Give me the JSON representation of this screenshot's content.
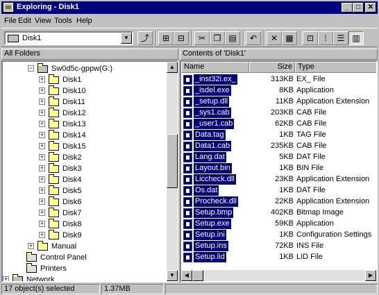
{
  "window": {
    "title": "Exploring - Disk1",
    "min": "_",
    "max": "□",
    "close": "✕"
  },
  "menu": [
    "File",
    "Edit",
    "View",
    "Tools",
    "Help"
  ],
  "address": {
    "value": "Disk1"
  },
  "panes": {
    "left_title": "All Folders",
    "right_title": "Contents of 'Disk1'"
  },
  "tree": [
    {
      "label": "Sw0d5c-gppw(G:)",
      "level": 0,
      "exp": "−",
      "type": "drive"
    },
    {
      "label": "Disk1",
      "level": 1,
      "exp": "+",
      "type": "open"
    },
    {
      "label": "Disk10",
      "level": 1,
      "exp": "+",
      "type": "folder"
    },
    {
      "label": "Disk11",
      "level": 1,
      "exp": "+",
      "type": "folder"
    },
    {
      "label": "Disk12",
      "level": 1,
      "exp": "+",
      "type": "folder"
    },
    {
      "label": "Disk13",
      "level": 1,
      "exp": "+",
      "type": "folder"
    },
    {
      "label": "Disk14",
      "level": 1,
      "exp": "+",
      "type": "folder"
    },
    {
      "label": "Disk15",
      "level": 1,
      "exp": "+",
      "type": "folder"
    },
    {
      "label": "Disk2",
      "level": 1,
      "exp": "+",
      "type": "folder"
    },
    {
      "label": "Disk3",
      "level": 1,
      "exp": "+",
      "type": "folder"
    },
    {
      "label": "Disk4",
      "level": 1,
      "exp": "+",
      "type": "folder"
    },
    {
      "label": "Disk5",
      "level": 1,
      "exp": "+",
      "type": "folder"
    },
    {
      "label": "Disk6",
      "level": 1,
      "exp": "+",
      "type": "folder"
    },
    {
      "label": "Disk7",
      "level": 1,
      "exp": "+",
      "type": "folder"
    },
    {
      "label": "Disk8",
      "level": 1,
      "exp": "+",
      "type": "folder"
    },
    {
      "label": "Disk9",
      "level": 1,
      "exp": "+",
      "type": "folder"
    },
    {
      "label": "Manual",
      "level": 0,
      "exp": "+",
      "type": "folder"
    },
    {
      "label": "Control Panel",
      "level": -1,
      "exp": "",
      "type": "special"
    },
    {
      "label": "Printers",
      "level": -1,
      "exp": "",
      "type": "special"
    },
    {
      "label": "Network",
      "level": -2,
      "exp": "+",
      "type": "network"
    }
  ],
  "columns": {
    "name": "Name",
    "size": "Size",
    "type": "Type"
  },
  "files": [
    {
      "name": "_inst32i.ex_",
      "size": "313KB",
      "type": "EX_ File"
    },
    {
      "name": "_isdel.exe",
      "size": "8KB",
      "type": "Application"
    },
    {
      "name": "_setup.dll",
      "size": "11KB",
      "type": "Application Extension"
    },
    {
      "name": "_sys1.cab",
      "size": "203KB",
      "type": "CAB File"
    },
    {
      "name": "_user1.cab",
      "size": "62KB",
      "type": "CAB File"
    },
    {
      "name": "Data.tag",
      "size": "1KB",
      "type": "TAG File"
    },
    {
      "name": "Data1.cab",
      "size": "235KB",
      "type": "CAB File"
    },
    {
      "name": "Lang.dat",
      "size": "5KB",
      "type": "DAT File"
    },
    {
      "name": "Layout.bin",
      "size": "1KB",
      "type": "BIN File"
    },
    {
      "name": "Liccheck.dll",
      "size": "23KB",
      "type": "Application Extension"
    },
    {
      "name": "Os.dat",
      "size": "1KB",
      "type": "DAT File"
    },
    {
      "name": "Procheck.dll",
      "size": "22KB",
      "type": "Application Extension"
    },
    {
      "name": "Setup.bmp",
      "size": "402KB",
      "type": "Bitmap Image"
    },
    {
      "name": "Setup.exe",
      "size": "59KB",
      "type": "Application"
    },
    {
      "name": "Setup.ini",
      "size": "1KB",
      "type": "Configuration Settings"
    },
    {
      "name": "Setup.ins",
      "size": "72KB",
      "type": "INS File"
    },
    {
      "name": "Setup.lid",
      "size": "1KB",
      "type": "LID File"
    }
  ],
  "status": {
    "selected": "17 object(s) selected",
    "size": "1.37MB"
  }
}
